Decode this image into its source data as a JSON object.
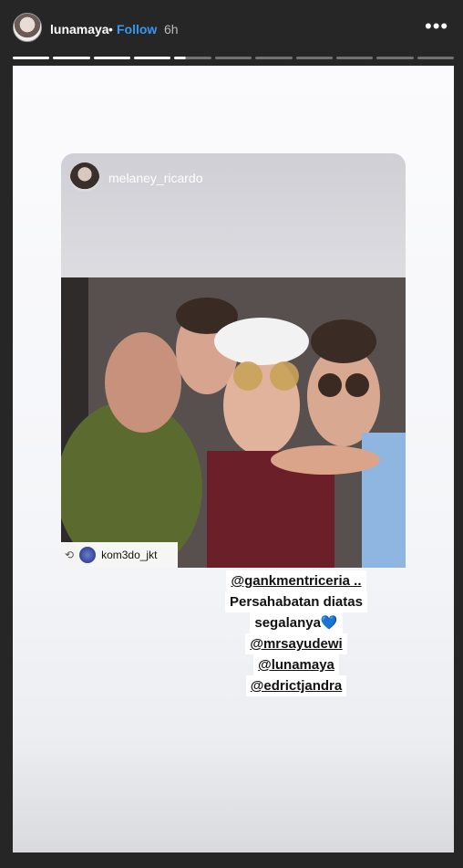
{
  "header": {
    "username": "lunamaya",
    "dot": "•",
    "follow_label": "Follow",
    "time": "6h",
    "more_icon": "more-icon"
  },
  "progress": {
    "total_segments": 11,
    "completed_segments": 4,
    "current_segment_progress": 0.3
  },
  "card": {
    "username": "melaney_ricardo",
    "repost_label": "kom3do_jkt"
  },
  "caption": {
    "line1": "@gankmentriceria ..",
    "line2": "Persahabatan diatas",
    "line3": "segalanya",
    "heart": "💙",
    "line4": "@mrsayudewi",
    "line5": "@lunamaya",
    "line6": "@edrictjandra"
  },
  "colors": {
    "follow": "#3897f0",
    "header_bg": "#262626"
  }
}
